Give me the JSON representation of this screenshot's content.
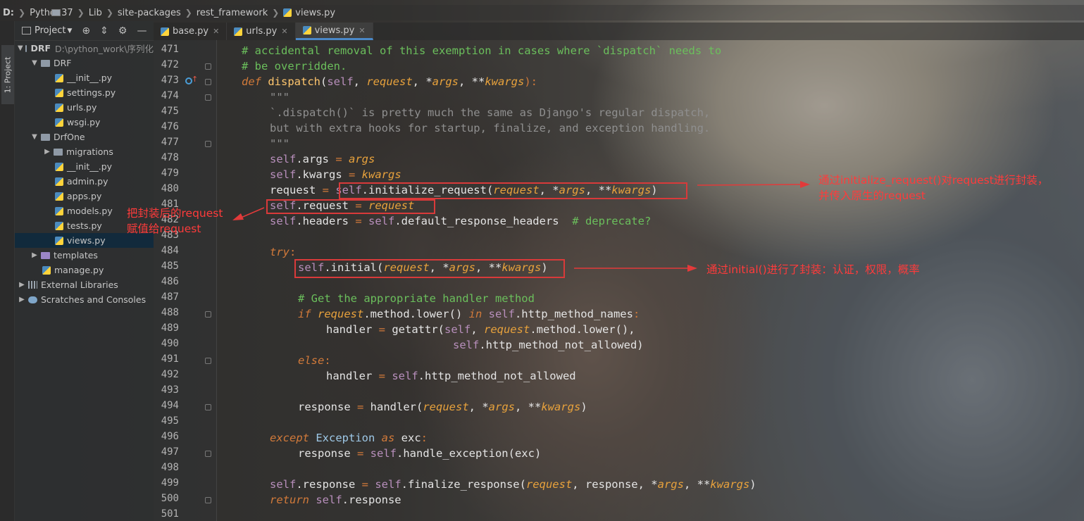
{
  "breadcrumb": [
    "D:",
    "Python37",
    "Lib",
    "site-packages",
    "rest_framework",
    "views.py"
  ],
  "strip_tab": "1: Project",
  "project": {
    "header": "Project",
    "tree": [
      {
        "label": "DRF",
        "path": "D:\\python_work\\序列化"
      },
      {
        "label": "DRF"
      },
      {
        "label": "__init__.py"
      },
      {
        "label": "settings.py"
      },
      {
        "label": "urls.py"
      },
      {
        "label": "wsgi.py"
      },
      {
        "label": "DrfOne"
      },
      {
        "label": "migrations"
      },
      {
        "label": "__init__.py"
      },
      {
        "label": "admin.py"
      },
      {
        "label": "apps.py"
      },
      {
        "label": "models.py"
      },
      {
        "label": "tests.py"
      },
      {
        "label": "views.py"
      },
      {
        "label": "templates"
      },
      {
        "label": "manage.py"
      },
      {
        "label": "External Libraries"
      },
      {
        "label": "Scratches and Consoles"
      }
    ]
  },
  "tabs": [
    "base.py",
    "urls.py",
    "views.py"
  ],
  "active_tab": "views.py",
  "line_numbers": [
    "471",
    "472",
    "473",
    "474",
    "475",
    "476",
    "477",
    "478",
    "479",
    "480",
    "481",
    "482",
    "483",
    "484",
    "485",
    "486",
    "487",
    "488",
    "489",
    "490",
    "491",
    "492",
    "493",
    "494",
    "495",
    "496",
    "497",
    "498",
    "499",
    "500",
    "501"
  ],
  "code": {
    "l471": "# accidental removal of this exemption in cases where `dispatch` needs to",
    "l472": "# be overridden.",
    "l473a": "def",
    "l473b": "dispatch",
    "l473c": "(",
    "l473d": "self",
    "l473e": ", ",
    "l473f": "request",
    "l473g": ", *",
    "l473h": "args",
    "l473i": ", **",
    "l473j": "kwargs",
    "l473k": "):",
    "l474": "\"\"\"",
    "l475": "`.dispatch()` is pretty much the same as Django's regular dispatch,",
    "l476": "but with extra hooks for startup, finalize, and exception handling.",
    "l477": "\"\"\"",
    "l478a": "self",
    "l478b": ".args ",
    "l478c": "= ",
    "l478d": "args",
    "l479a": "self",
    "l479b": ".kwargs ",
    "l479c": "= ",
    "l479d": "kwargs",
    "l480a": "request ",
    "l480b": "= ",
    "l480c": "self",
    ".l480d": "",
    "l480e": ".initialize_request(",
    "l480f": "request",
    "l480g": ", *",
    "l480h": "args",
    "l480i": ", **",
    "l480j": "kwargs",
    "l480k": ")",
    "l481a": "self",
    "l481b": ".request ",
    "l481c": "= ",
    "l481d": "request",
    "l482a": "self",
    "l482b": ".headers ",
    "l482c": "= ",
    "l482d": "self",
    "l482e": ".default_response_headers  ",
    "l482f": "# deprecate?",
    "l484a": "try",
    "l484b": ":",
    "l485a": "self",
    "l485b": ".initial(",
    "l485c": "request",
    "l485d": ", *",
    "l485e": "args",
    "l485f": ", **",
    "l485g": "kwargs",
    "l485h": ")",
    "l487": "# Get the appropriate handler method",
    "l488a": "if ",
    "l488b": "request",
    "l488c": ".method.lower() ",
    "l488d": "in ",
    "l488e": "self",
    "l488f": ".http_method_names",
    ":": "",
    "l489a": "handler ",
    "l489b": "= ",
    "l489c": "getattr(",
    "l489d": "self",
    "l489e": ", ",
    "l489f": "request",
    "l489g": ".method.lower(),",
    "l490a": "self",
    "l490b": ".http_method_not_allowed)",
    "l491a": "else",
    "l491b": ":",
    "l492a": "handler ",
    "l492b": "= ",
    "l492c": "self",
    "l492d": ".http_method_not_allowed",
    "l494a": "response ",
    "l494b": "= ",
    "l494c": "handler(",
    "l494d": "request",
    "l494e": ", *",
    "l494f": "args",
    "l494g": ", **",
    "l494h": "kwargs",
    "l494i": ")",
    "l496a": "except ",
    "l496b": "Exception ",
    "l496c": "as ",
    "l496d": "exc",
    "l497a": "response ",
    "l497b": "= ",
    "l497c": "self",
    "l497d": ".handle_exception(exc)",
    "l499a": "self",
    "l499b": ".response ",
    "l499c": "= ",
    "l499d": "self",
    "l499e": ".finalize_response(",
    "l499f": "request",
    "l499g": ", response, *",
    "l499h": "args",
    "l499i": ", **",
    "l499j": "kwargs",
    "l499k": ")",
    "l500a": "return ",
    "l500b": "self",
    "l500c": ".response"
  },
  "annotations": {
    "a1_line1": "通过initialize_request()对request进行封装，",
    "a1_line2": "并传入原生的request",
    "a2_line1": "把封装后的request",
    "a2_line2": "赋值给request",
    "a3": "通过initial()进行了封装：认证，权限，概率"
  },
  "colors": {
    "annotation": "#ff3b3b",
    "keyword": "#d27a3a",
    "self": "#b88fbc",
    "param": "#e8a23c",
    "comment": "#6bbf5c",
    "selection": "#0d293e"
  }
}
